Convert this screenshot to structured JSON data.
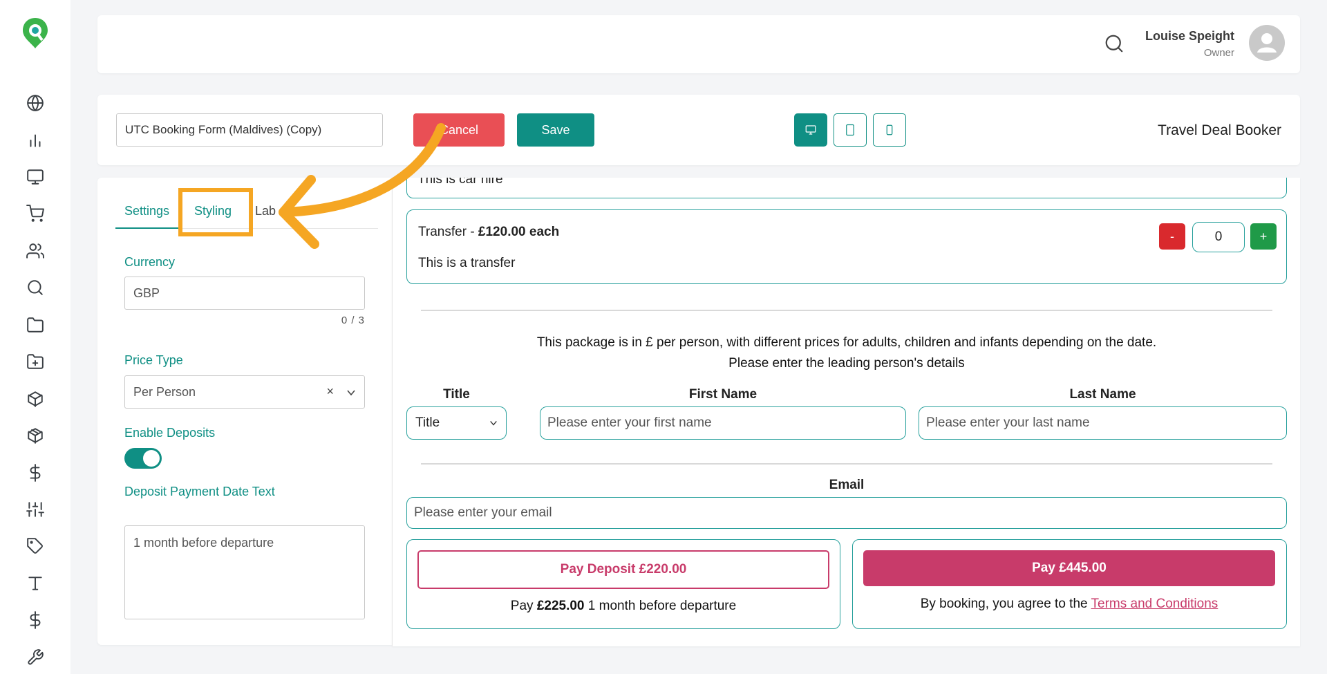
{
  "sidebar": {
    "icons": [
      "logo-icon",
      "globe-icon",
      "bar-chart-icon",
      "monitor-icon",
      "cart-icon",
      "users-icon",
      "search-icon",
      "folder-icon",
      "folder-plus-icon",
      "box-icon",
      "package-icon",
      "dollar-icon",
      "sliders-icon",
      "tag-icon",
      "text-icon",
      "dollar-icon",
      "wrench-icon"
    ],
    "colors": {
      "accent": "#0f8f84",
      "logo_green": "#3bb34a"
    }
  },
  "header": {
    "user_name": "Louise Speight",
    "user_role": "Owner"
  },
  "toolbar": {
    "form_name": "UTC Booking Form (Maldives) (Copy)",
    "cancel_label": "Cancel",
    "save_label": "Save",
    "device_buttons": [
      "desktop-icon",
      "tablet-icon",
      "mobile-icon"
    ],
    "app_title": "Travel Deal Booker"
  },
  "settings_panel": {
    "tabs": [
      "Settings",
      "Styling",
      "Lab"
    ],
    "active_tab": "Settings",
    "currency_label": "Currency",
    "currency_value": "GBP",
    "currency_counter": "0 / 3",
    "price_type_label": "Price Type",
    "price_type_value": "Per Person",
    "price_type_clear": "×",
    "enable_deposits_label": "Enable Deposits",
    "enable_deposits_on": true,
    "deposit_date_label": "Deposit Payment Date Text",
    "deposit_date_value": "1 month before departure"
  },
  "preview": {
    "car_hire_text": "This is car hire",
    "transfer": {
      "name": "Transfer - ",
      "price": "£120.00 each",
      "description": "This is a transfer",
      "minus": "-",
      "quantity": "0",
      "plus": "+"
    },
    "package_info": "This package is in £ per person, with different prices for adults, children and infants depending on the date.",
    "lead_info": "Please enter the leading person's details",
    "title_label": "Title",
    "title_select": "Title",
    "first_name_label": "First Name",
    "first_name_placeholder": "Please enter your first name",
    "last_name_label": "Last Name",
    "last_name_placeholder": "Please enter your last name",
    "email_label": "Email",
    "email_placeholder": "Please enter your email",
    "deposit_button": "Pay Deposit £220.00",
    "deposit_note_pre": "Pay ",
    "deposit_note_amount": "£225.00",
    "deposit_note_post": " 1 month before departure",
    "pay_button": "Pay £445.00",
    "terms_pre": "By booking, you agree to the ",
    "terms_link": "Terms and Conditions"
  },
  "annotation": {
    "highlight": "Styling",
    "color": "#f5a623"
  }
}
